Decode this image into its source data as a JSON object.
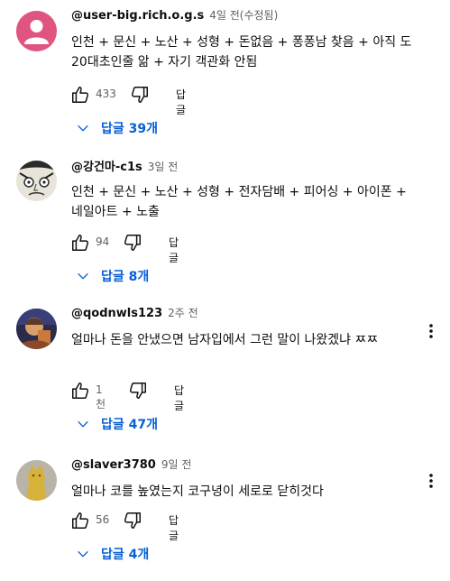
{
  "comments": [
    {
      "author": "@user-big.rich.o.g.s",
      "time": "4일 전(수정됨)",
      "text": "인천 + 문신 + 노산 + 성형 + 돈없음 + 퐁퐁남 찾음 + 아직 도 20대초인줄 앎 + 자기 객관화 안됨",
      "likes": "433",
      "reply_label": "답글",
      "replies_label": "답글 39개",
      "avatar_icon": "default-person-avatar"
    },
    {
      "author": "@강건마-c1s",
      "time": "3일 전",
      "text": "인천 + 문신 + 노산 + 성형 + 전자담배 + 피어싱 + 아이폰 + 네일아트 + 노출",
      "likes": "94",
      "reply_label": "답글",
      "replies_label": "답글 8개",
      "avatar_icon": "cartoon-face-avatar"
    },
    {
      "author": "@qodnwls123",
      "time": "2주 전",
      "text": "얼마나 돈을 안냈으면 남자입에서 그런 말이 나왔겠냐 ㅉㅉ",
      "likes": "1천",
      "reply_label": "답글",
      "replies_label": "답글 47개",
      "avatar_icon": "photo-avatar"
    },
    {
      "author": "@slaver3780",
      "time": "9일 전",
      "text": "얼마나 코를 높였는지 코구녕이 세로로 닫히것다",
      "likes": "56",
      "reply_label": "답글",
      "replies_label": "답글 4개",
      "avatar_icon": "golden-figure-avatar"
    }
  ],
  "colors": {
    "link_blue": "#065fd4",
    "secondary_text": "#606060",
    "primary_text": "#0f0f0f",
    "avatar_pink": "#e0557f"
  }
}
